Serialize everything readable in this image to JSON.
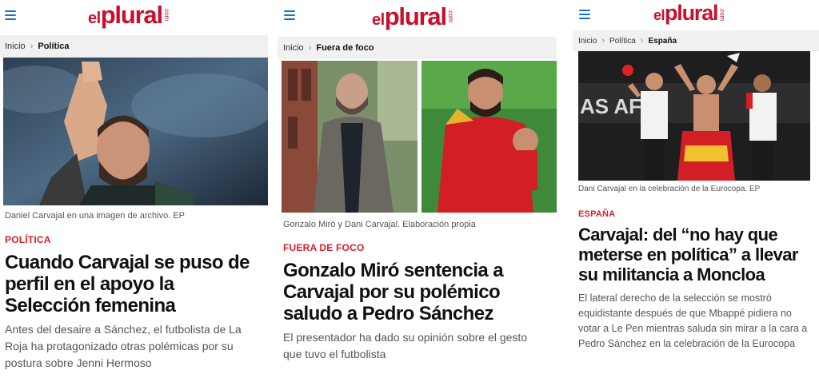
{
  "articles": [
    {
      "logo": {
        "el": "el",
        "plural": "plural",
        "com": ".com"
      },
      "breadcrumb": {
        "home": "Inicio",
        "current": "Política"
      },
      "caption": "Daniel Carvajal en una imagen de archivo. EP",
      "section": "POLÍTICA",
      "headline": "Cuando Carvajal se puso de perfil en el apoyo la Selección femenina",
      "lead": "Antes del desaire a Sánchez, el futbolista de La Roja ha protagonizado otras polémicas por su postura sobre Jenni Hermoso"
    },
    {
      "logo": {
        "el": "el",
        "plural": "plural",
        "com": ".com"
      },
      "breadcrumb": {
        "home": "Inicio",
        "current": "Fuera de foco"
      },
      "caption": "Gonzalo Miró y Dani Carvajal. Elaboración propia",
      "section": "FUERA DE FOCO",
      "headline": "Gonzalo Miró sentencia a Carvajal por su polémico saludo a Pedro Sánchez",
      "lead": "El presentador ha dado su opinión sobre el gesto que tuvo el futbolista"
    },
    {
      "logo": {
        "el": "el",
        "plural": "plural",
        "com": ".com"
      },
      "breadcrumb": {
        "home": "Inicio",
        "mid": "Política",
        "current": "España"
      },
      "caption": "Dani Carvajal en la celebración de la Eurocopa. EP",
      "section": "ESPAÑA",
      "headline": "Carvajal: del “no hay que meterse en política” a llevar su militancia a Moncloa",
      "lead": "El lateral derecho de la selección se mostró equidistante después de que Mbappé pidiera no votar a Le Pen mientras saluda sin mirar a la cara a Pedro Sánchez en la celebración de la Eurocopa",
      "photo_text": "AS AFIC"
    }
  ],
  "colors": {
    "brand": "#c8102e",
    "section": "#d81e2c",
    "menu": "#1a73c8",
    "crumb_bg": "#f1f1f1"
  },
  "icons": {
    "menu": "hamburger-icon",
    "breadcrumb_separator": "chevron-right-icon"
  }
}
